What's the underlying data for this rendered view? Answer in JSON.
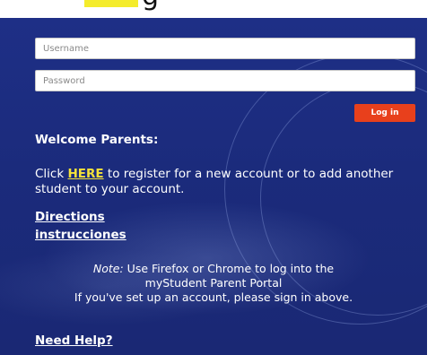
{
  "header": {
    "partial_text": "g"
  },
  "login": {
    "username_placeholder": "Username",
    "password_placeholder": "Password",
    "button_label": "Log in"
  },
  "welcome": {
    "title": "Welcome Parents:",
    "register_prefix": "Click ",
    "register_link": "HERE",
    "register_suffix": " to register for a new account or to add another student to your account."
  },
  "links": {
    "directions": "Directions",
    "instrucciones": "instrucciones",
    "need_help": "Need Help?"
  },
  "note": {
    "label": "Note:",
    "line1": " Use Firefox or Chrome to log into the",
    "line2": "myStudent Parent Portal",
    "line3": "If you've set up an account, please sign in above."
  },
  "colors": {
    "panel_background": "#1b2b7c",
    "login_button": "#e8401c",
    "here_link": "#f4e23a",
    "header_highlight": "#f4ec2c"
  }
}
